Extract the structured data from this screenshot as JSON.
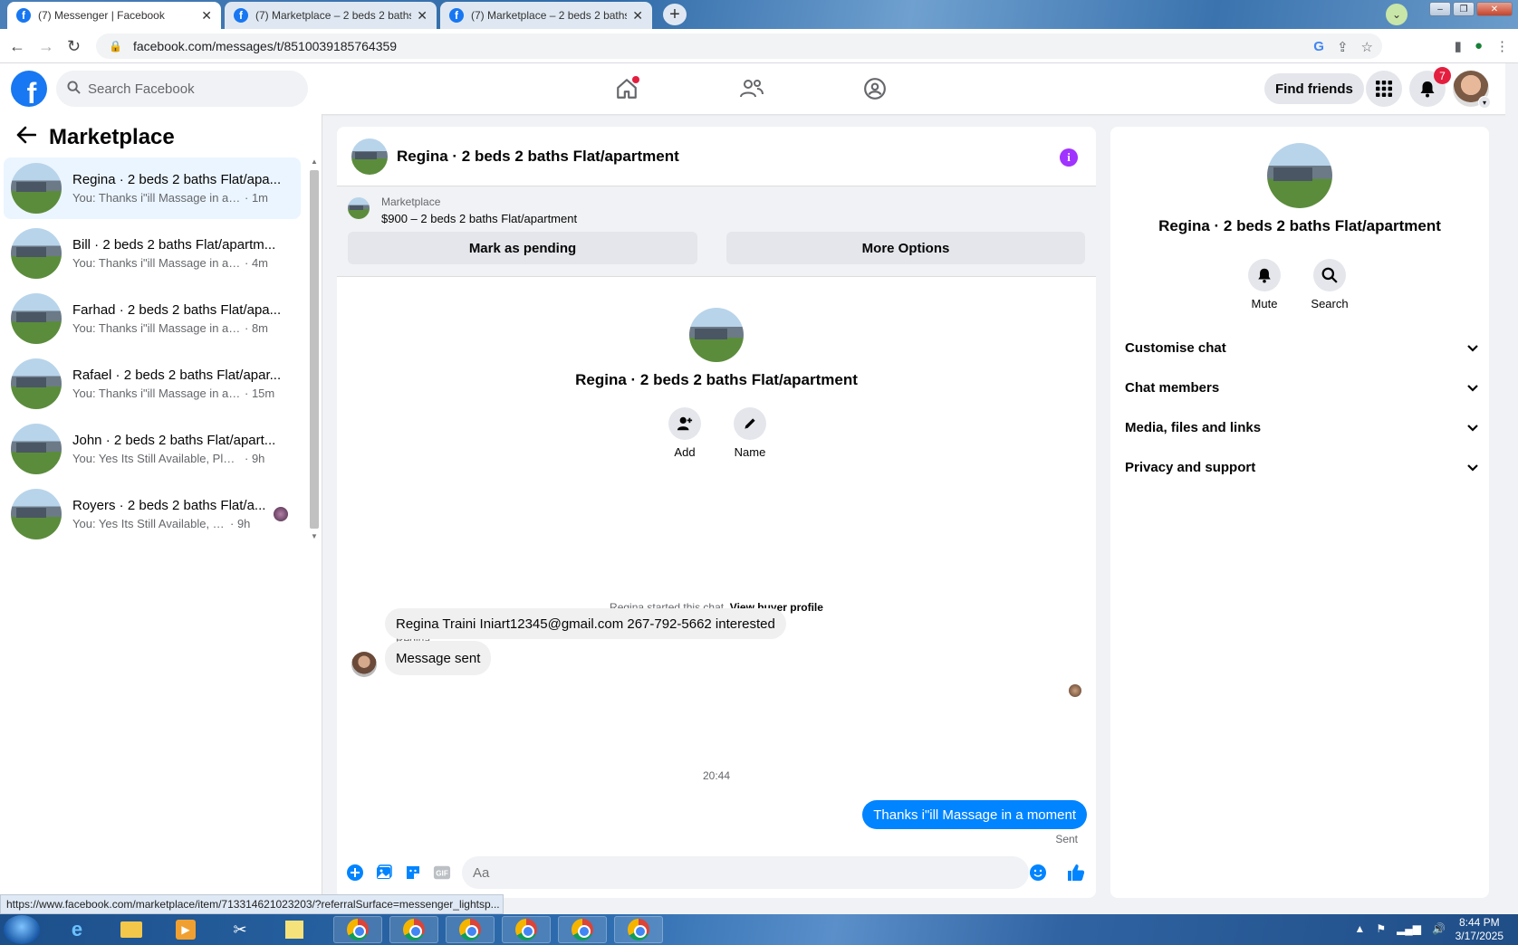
{
  "browser": {
    "tabs": [
      {
        "title": "(7) Messenger | Facebook",
        "active": true
      },
      {
        "title": "(7) Marketplace – 2 beds 2 baths",
        "active": false
      },
      {
        "title": "(7) Marketplace – 2 beds 2 baths",
        "active": false
      }
    ],
    "url": "facebook.com/messages/t/8510039185764359",
    "status_url": "https://www.facebook.com/marketplace/item/713314621023203/?referralSurface=messenger_lightsp..."
  },
  "header": {
    "logo": "f",
    "search_placeholder": "Search Facebook",
    "find_friends": "Find friends",
    "notification_count": "7"
  },
  "sidebar": {
    "title": "Marketplace",
    "conversations": [
      {
        "name": "Regina · 2 beds 2 baths Flat/apa...",
        "snippet": "You: Thanks i\"ill Massage in a mo...",
        "time": "· 1m",
        "active": true
      },
      {
        "name": "Bill · 2 beds 2 baths Flat/apartm...",
        "snippet": "You: Thanks i\"ill Massage in a mo...",
        "time": "· 4m",
        "active": false
      },
      {
        "name": "Farhad · 2 beds 2 baths Flat/apa...",
        "snippet": "You: Thanks i\"ill Massage in a mo...",
        "time": "· 8m",
        "active": false
      },
      {
        "name": "Rafael · 2 beds 2 baths Flat/apar...",
        "snippet": "You: Thanks i\"ill Massage in a mo...",
        "time": "· 15m",
        "active": false
      },
      {
        "name": "John · 2 beds 2 baths Flat/apart...",
        "snippet": "You: Yes Its Still Available, Please Se...",
        "time": "· 9h",
        "active": false
      },
      {
        "name": "Royers · 2 beds 2 baths Flat/a...",
        "snippet": "You: Yes Its Still Available, Please...",
        "time": "· 9h",
        "active": false
      }
    ]
  },
  "chat": {
    "title": "Regina · 2 beds 2 baths Flat/apartment",
    "marketplace_label": "Marketplace",
    "listing": "$900 – 2 beds 2 baths Flat/apartment",
    "mark_pending": "Mark as pending",
    "more_options": "More Options",
    "hero_title": "Regina · 2 beds 2 baths Flat/apartment",
    "add_label": "Add",
    "name_label": "Name",
    "started_text": "Regina started this chat.",
    "view_buyer": "View buyer profile",
    "sender": "Regina",
    "messages_in": [
      "Regina Traini Iniart12345@gmail.com 267-792-5662 interested",
      "Message sent"
    ],
    "time_divider": "20:44",
    "message_out": "Thanks i\"ill Massage in a moment",
    "sent_label": "Sent",
    "composer_placeholder": "Aa"
  },
  "right_panel": {
    "title": "Regina · 2 beds 2 baths Flat/apartment",
    "mute": "Mute",
    "search": "Search",
    "sections": [
      "Customise chat",
      "Chat members",
      "Media, files and links",
      "Privacy and support"
    ]
  },
  "taskbar": {
    "time": "8:44 PM",
    "date": "3/17/2025"
  }
}
